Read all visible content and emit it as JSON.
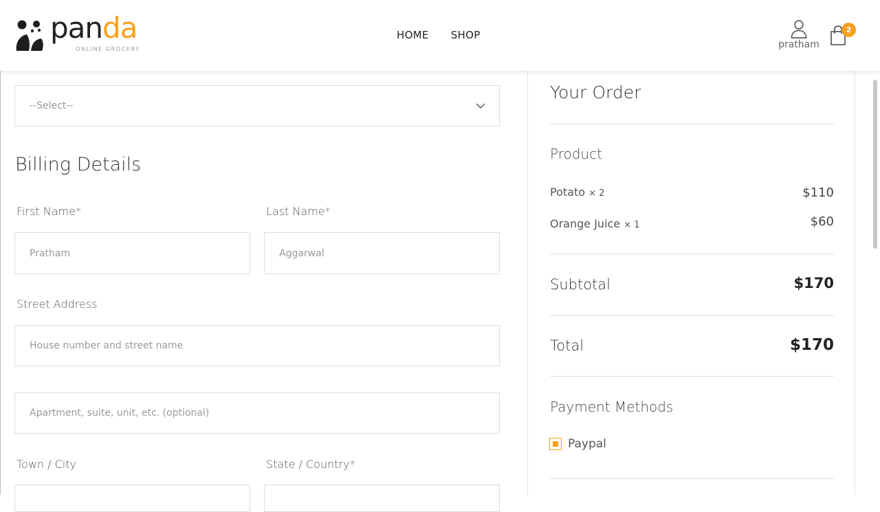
{
  "brand": {
    "name_part1": "pan",
    "name_part2": "da",
    "tagline": "ONLINE GROCERY",
    "accent_color": "#f7a01e"
  },
  "nav": {
    "items": [
      {
        "label": "HOME"
      },
      {
        "label": "SHOP"
      }
    ]
  },
  "user": {
    "name": "pratham",
    "icon": "user-icon"
  },
  "cart": {
    "icon": "shopping-bag-icon",
    "count": "2"
  },
  "form": {
    "select": {
      "value": "--Select--",
      "icon": "chevron-down-icon"
    },
    "section_title": "Billing Details",
    "first_name": {
      "label": "First Name*",
      "placeholder": "Pratham"
    },
    "last_name": {
      "label": "Last Name*",
      "placeholder": "Aggarwal"
    },
    "street": {
      "label": "Street Address",
      "placeholder_line1": "House number and street name",
      "placeholder_line2": "Apartment, suite, unit, etc. (optional)"
    },
    "town": {
      "label": "Town / City"
    },
    "state": {
      "label": "State / Country*"
    }
  },
  "order": {
    "title": "Your Order",
    "product_header": "Product",
    "items": [
      {
        "name": "Potato",
        "qty": "× 2",
        "price": "$110"
      },
      {
        "name": "Orange Juice",
        "qty": "× 1",
        "price": "$60"
      }
    ],
    "subtotal": {
      "label": "Subtotal",
      "value": "$170"
    },
    "total": {
      "label": "Total",
      "value": "$170"
    },
    "payment": {
      "header": "Payment Methods",
      "options": [
        {
          "label": "Paypal",
          "selected": true
        }
      ]
    }
  }
}
